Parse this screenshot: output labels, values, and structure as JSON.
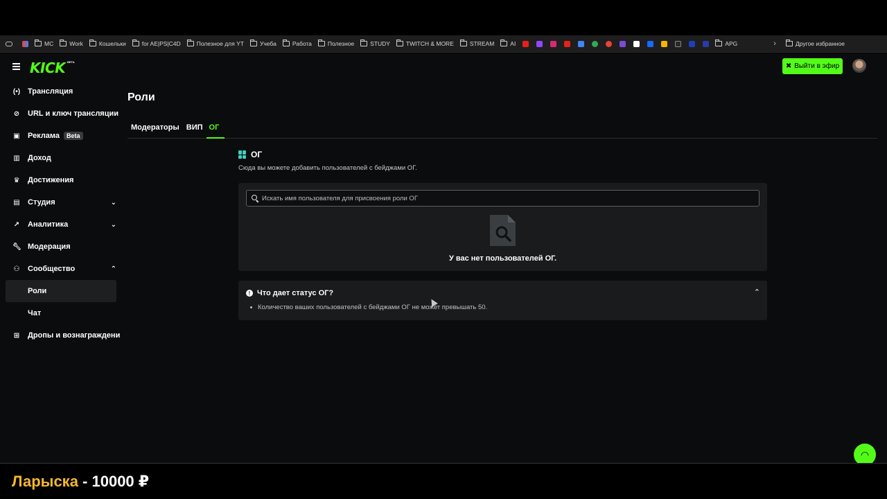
{
  "bookmarks": {
    "items": [
      "MC",
      "Work",
      "Кошельки",
      "for AE|PS|C4D",
      "Полезное для YT",
      "Учеба",
      "Работа",
      "Полезное",
      "STUDY",
      "TWITCH & MORE",
      "STREAM",
      "AI"
    ],
    "last": "APG",
    "other": "Другое избранное"
  },
  "header": {
    "logo": "KICK",
    "logo_badge": "BETA",
    "go_live_label": "Выйти в эфир",
    "accent": "#53fc18"
  },
  "sidebar": {
    "items": [
      {
        "label": "Трансляция",
        "icon": "broadcast-icon"
      },
      {
        "label": "URL и ключ трансляции",
        "icon": "link-icon"
      },
      {
        "label": "Реклама",
        "icon": "ad-icon",
        "badge": "Beta"
      },
      {
        "label": "Доход",
        "icon": "income-icon"
      },
      {
        "label": "Достижения",
        "icon": "trophy-icon"
      },
      {
        "label": "Студия",
        "icon": "studio-icon"
      },
      {
        "label": "Аналитика",
        "icon": "analytics-icon"
      },
      {
        "label": "Модерация",
        "icon": "wrench-icon"
      },
      {
        "label": "Сообщество",
        "icon": "community-icon"
      },
      {
        "label": "Роли"
      },
      {
        "label": "Чат"
      },
      {
        "label": "Дропы и вознаграждени",
        "icon": "gift-icon"
      }
    ]
  },
  "main": {
    "title": "Роли",
    "tabs": [
      "Модераторы",
      "ВИП",
      "ОГ"
    ],
    "section_title": "ОГ",
    "section_desc": "Сюда вы можете добавить пользователей с бейджами ОГ.",
    "search_placeholder": "Искать имя пользователя для присвоения роли ОГ",
    "empty_text": "У вас нет пользователей ОГ.",
    "faq_question": "Что дает статус ОГ?",
    "faq_answer": "Количество ваших пользователей с бейджами ОГ не может превышать 50."
  },
  "overlay": {
    "name": "Ларыска",
    "amount": " - 10000 ₽"
  }
}
